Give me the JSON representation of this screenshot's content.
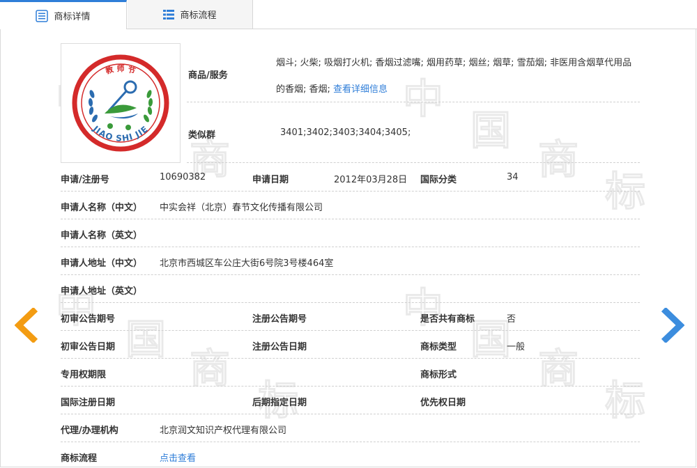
{
  "tabs": [
    {
      "label": "商标详情"
    },
    {
      "label": "商标流程"
    }
  ],
  "logo": {
    "top_text": "教 师 节",
    "bottom_text": "JIAO SHI JIE",
    "colors": {
      "ring": "#d42a2a",
      "key": "#2b6cb0",
      "leaf": "#3a9a3a"
    }
  },
  "watermark": {
    "chars": [
      "中",
      "国",
      "商",
      "标"
    ]
  },
  "goods": {
    "label": "商品/服务",
    "text": "烟斗; 火柴; 吸烟打火机; 香烟过滤嘴; 烟用药草; 烟丝; 烟草; 雪茄烟; 非医用含烟草代用品的香烟; 香烟; ",
    "link": "查看详细信息"
  },
  "similar": {
    "label": "类似群",
    "value": "3401;3402;3403;3404;3405;"
  },
  "reg": {
    "label": "申请/注册号",
    "value": "10690382",
    "date_label": "申请日期",
    "date_value": "2012年03月28日",
    "class_label": "国际分类",
    "class_value": "34"
  },
  "applicant_cn": {
    "label": "申请人名称（中文）",
    "value": "中实会祥（北京）春节文化传播有限公司"
  },
  "applicant_en": {
    "label": "申请人名称（英文）",
    "value": ""
  },
  "address_cn": {
    "label": "申请人地址（中文）",
    "value": "北京市西城区车公庄大街6号院3号楼464室"
  },
  "address_en": {
    "label": "申请人地址（英文）",
    "value": ""
  },
  "row_pub": {
    "a_label": "初审公告期号",
    "a_value": "",
    "b_label": "注册公告期号",
    "b_value": "",
    "c_label": "是否共有商标",
    "c_value": "否"
  },
  "row_pubdate": {
    "a_label": "初审公告日期",
    "a_value": "",
    "b_label": "注册公告日期",
    "b_value": "",
    "c_label": "商标类型",
    "c_value": "一般"
  },
  "row_right": {
    "a_label": "专用权期限",
    "a_value": "",
    "c_label": "商标形式",
    "c_value": ""
  },
  "row_intl": {
    "a_label": "国际注册日期",
    "a_value": "",
    "b_label": "后期指定日期",
    "b_value": "",
    "c_label": "优先权日期",
    "c_value": ""
  },
  "agent": {
    "label": "代理/办理机构",
    "value": "北京润文知识产权代理有限公司"
  },
  "flow": {
    "label": "商标流程",
    "link": "点击查看"
  },
  "arrows": {
    "left_color": "#f39c12",
    "right_color": "#3c8dde"
  }
}
